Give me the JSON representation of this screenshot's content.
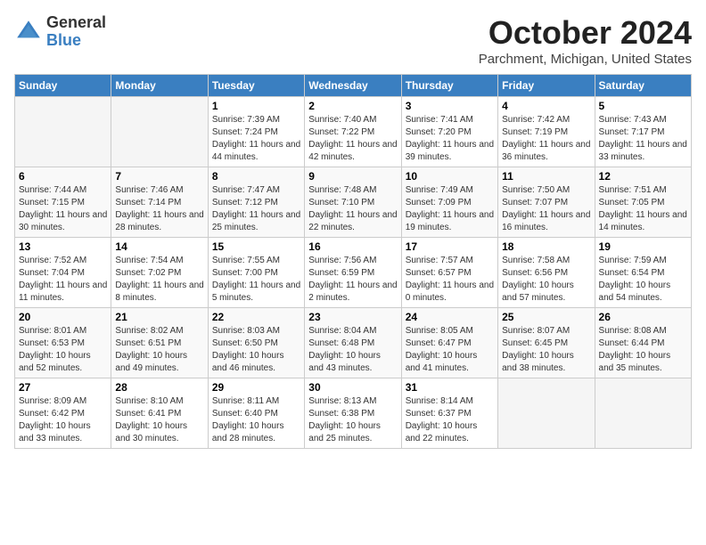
{
  "logo": {
    "general": "General",
    "blue": "Blue"
  },
  "title": "October 2024",
  "location": "Parchment, Michigan, United States",
  "days": [
    "Sunday",
    "Monday",
    "Tuesday",
    "Wednesday",
    "Thursday",
    "Friday",
    "Saturday"
  ],
  "weeks": [
    [
      {
        "day": "",
        "info": ""
      },
      {
        "day": "",
        "info": ""
      },
      {
        "day": "1",
        "info": "Sunrise: 7:39 AM\nSunset: 7:24 PM\nDaylight: 11 hours and 44 minutes."
      },
      {
        "day": "2",
        "info": "Sunrise: 7:40 AM\nSunset: 7:22 PM\nDaylight: 11 hours and 42 minutes."
      },
      {
        "day": "3",
        "info": "Sunrise: 7:41 AM\nSunset: 7:20 PM\nDaylight: 11 hours and 39 minutes."
      },
      {
        "day": "4",
        "info": "Sunrise: 7:42 AM\nSunset: 7:19 PM\nDaylight: 11 hours and 36 minutes."
      },
      {
        "day": "5",
        "info": "Sunrise: 7:43 AM\nSunset: 7:17 PM\nDaylight: 11 hours and 33 minutes."
      }
    ],
    [
      {
        "day": "6",
        "info": "Sunrise: 7:44 AM\nSunset: 7:15 PM\nDaylight: 11 hours and 30 minutes."
      },
      {
        "day": "7",
        "info": "Sunrise: 7:46 AM\nSunset: 7:14 PM\nDaylight: 11 hours and 28 minutes."
      },
      {
        "day": "8",
        "info": "Sunrise: 7:47 AM\nSunset: 7:12 PM\nDaylight: 11 hours and 25 minutes."
      },
      {
        "day": "9",
        "info": "Sunrise: 7:48 AM\nSunset: 7:10 PM\nDaylight: 11 hours and 22 minutes."
      },
      {
        "day": "10",
        "info": "Sunrise: 7:49 AM\nSunset: 7:09 PM\nDaylight: 11 hours and 19 minutes."
      },
      {
        "day": "11",
        "info": "Sunrise: 7:50 AM\nSunset: 7:07 PM\nDaylight: 11 hours and 16 minutes."
      },
      {
        "day": "12",
        "info": "Sunrise: 7:51 AM\nSunset: 7:05 PM\nDaylight: 11 hours and 14 minutes."
      }
    ],
    [
      {
        "day": "13",
        "info": "Sunrise: 7:52 AM\nSunset: 7:04 PM\nDaylight: 11 hours and 11 minutes."
      },
      {
        "day": "14",
        "info": "Sunrise: 7:54 AM\nSunset: 7:02 PM\nDaylight: 11 hours and 8 minutes."
      },
      {
        "day": "15",
        "info": "Sunrise: 7:55 AM\nSunset: 7:00 PM\nDaylight: 11 hours and 5 minutes."
      },
      {
        "day": "16",
        "info": "Sunrise: 7:56 AM\nSunset: 6:59 PM\nDaylight: 11 hours and 2 minutes."
      },
      {
        "day": "17",
        "info": "Sunrise: 7:57 AM\nSunset: 6:57 PM\nDaylight: 11 hours and 0 minutes."
      },
      {
        "day": "18",
        "info": "Sunrise: 7:58 AM\nSunset: 6:56 PM\nDaylight: 10 hours and 57 minutes."
      },
      {
        "day": "19",
        "info": "Sunrise: 7:59 AM\nSunset: 6:54 PM\nDaylight: 10 hours and 54 minutes."
      }
    ],
    [
      {
        "day": "20",
        "info": "Sunrise: 8:01 AM\nSunset: 6:53 PM\nDaylight: 10 hours and 52 minutes."
      },
      {
        "day": "21",
        "info": "Sunrise: 8:02 AM\nSunset: 6:51 PM\nDaylight: 10 hours and 49 minutes."
      },
      {
        "day": "22",
        "info": "Sunrise: 8:03 AM\nSunset: 6:50 PM\nDaylight: 10 hours and 46 minutes."
      },
      {
        "day": "23",
        "info": "Sunrise: 8:04 AM\nSunset: 6:48 PM\nDaylight: 10 hours and 43 minutes."
      },
      {
        "day": "24",
        "info": "Sunrise: 8:05 AM\nSunset: 6:47 PM\nDaylight: 10 hours and 41 minutes."
      },
      {
        "day": "25",
        "info": "Sunrise: 8:07 AM\nSunset: 6:45 PM\nDaylight: 10 hours and 38 minutes."
      },
      {
        "day": "26",
        "info": "Sunrise: 8:08 AM\nSunset: 6:44 PM\nDaylight: 10 hours and 35 minutes."
      }
    ],
    [
      {
        "day": "27",
        "info": "Sunrise: 8:09 AM\nSunset: 6:42 PM\nDaylight: 10 hours and 33 minutes."
      },
      {
        "day": "28",
        "info": "Sunrise: 8:10 AM\nSunset: 6:41 PM\nDaylight: 10 hours and 30 minutes."
      },
      {
        "day": "29",
        "info": "Sunrise: 8:11 AM\nSunset: 6:40 PM\nDaylight: 10 hours and 28 minutes."
      },
      {
        "day": "30",
        "info": "Sunrise: 8:13 AM\nSunset: 6:38 PM\nDaylight: 10 hours and 25 minutes."
      },
      {
        "day": "31",
        "info": "Sunrise: 8:14 AM\nSunset: 6:37 PM\nDaylight: 10 hours and 22 minutes."
      },
      {
        "day": "",
        "info": ""
      },
      {
        "day": "",
        "info": ""
      }
    ]
  ]
}
